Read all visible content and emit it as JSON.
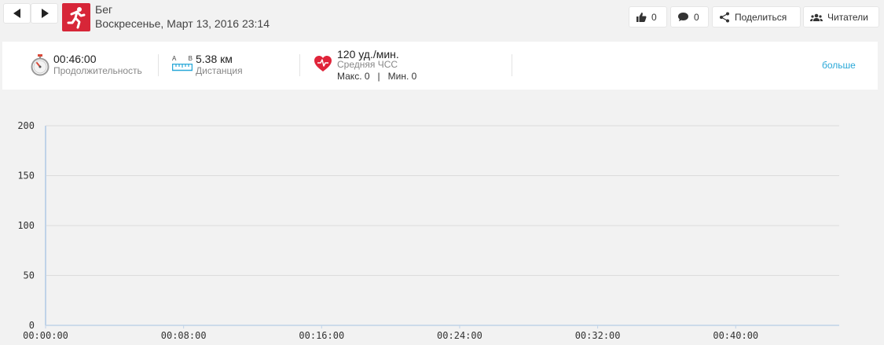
{
  "activity": {
    "sport": "Бег",
    "date": "Воскресенье, Март 13, 2016 23:14"
  },
  "toolbar": {
    "likes": "0",
    "comments": "0",
    "share_label": "Поделиться",
    "followers_label": "Читатели"
  },
  "stats": {
    "duration_value": "00:46:00",
    "duration_label": "Продолжительность",
    "distance_ab": [
      "A",
      "B"
    ],
    "distance_value": "5.38 км",
    "distance_label": "Дистанция",
    "hr_value": "120 уд./мин.",
    "hr_label": "Средняя ЧСС",
    "hr_minmax": "Макс. 0   |   Мин. 0",
    "more_label": "больше"
  },
  "colors": {
    "accent": "#d72638",
    "link": "#29a8d8",
    "distance_icon": "#29a8d8",
    "chart_axis": "#c0d3e8"
  },
  "icons": {
    "prev": "triangle-left-icon",
    "next": "triangle-right-icon",
    "sport": "running-man-icon",
    "like": "thumbs-up-icon",
    "comment": "speech-bubble-icon",
    "share": "share-icon",
    "followers": "people-icon",
    "duration": "stopwatch-icon",
    "distance": "ruler-icon",
    "heart_rate": "heart-icon"
  },
  "chart_data": {
    "type": "line",
    "title": "",
    "xlabel": "",
    "ylabel": "",
    "yticks": [
      0,
      50,
      100,
      150,
      200
    ],
    "ylim": [
      0,
      200
    ],
    "xticks": [
      "00:00:00",
      "00:08:00",
      "00:16:00",
      "00:24:00",
      "00:32:00",
      "00:40:00"
    ],
    "xlim_minutes": [
      0,
      46
    ],
    "grid": true,
    "series": []
  }
}
